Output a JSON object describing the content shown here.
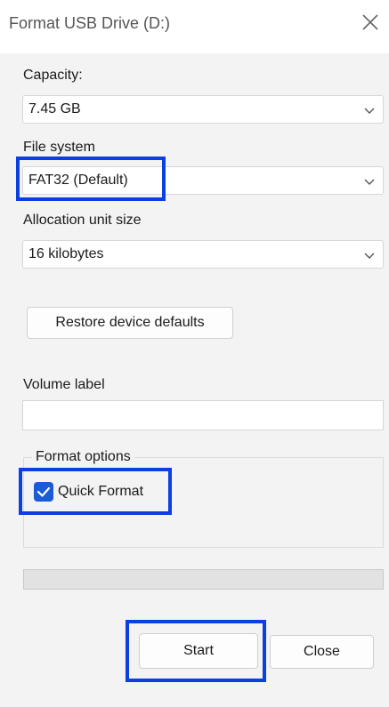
{
  "window": {
    "title": "Format USB Drive (D:)",
    "close_icon": "close-icon"
  },
  "capacity": {
    "label": "Capacity:",
    "value": "7.45 GB"
  },
  "file_system": {
    "label": "File system",
    "value": "FAT32 (Default)"
  },
  "allocation": {
    "label": "Allocation unit size",
    "value": "16 kilobytes"
  },
  "restore_button": {
    "label": "Restore device defaults"
  },
  "volume": {
    "label": "Volume label",
    "value": ""
  },
  "format_options": {
    "title": "Format options",
    "quick_format_label": "Quick Format",
    "quick_format_checked": true
  },
  "progress": {
    "value": 0
  },
  "buttons": {
    "start": "Start",
    "close": "Close"
  },
  "colors": {
    "highlight": "#0a3fe0",
    "accent": "#1c5bd6"
  }
}
